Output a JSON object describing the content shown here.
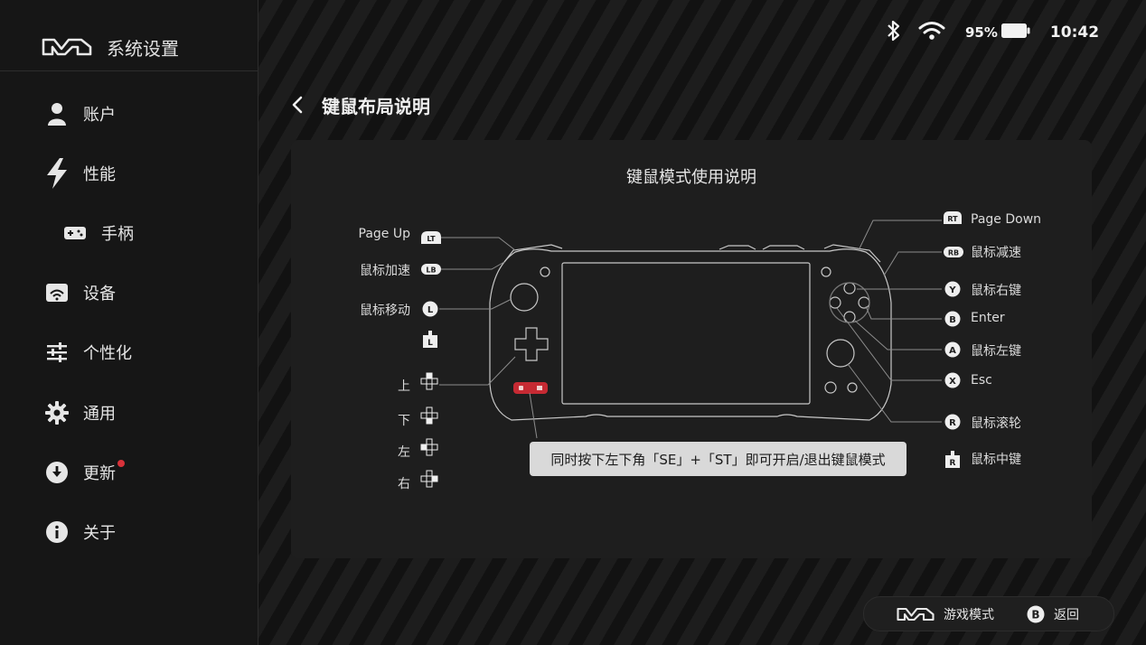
{
  "sidebar": {
    "app_title": "系统设置",
    "items": [
      {
        "label": "账户",
        "icon": "person-icon"
      },
      {
        "label": "性能",
        "icon": "lightning-icon"
      },
      {
        "label": "手柄",
        "icon": "gamepad-icon"
      },
      {
        "label": "设备",
        "icon": "device-icon"
      },
      {
        "label": "个性化",
        "icon": "sliders-icon"
      },
      {
        "label": "通用",
        "icon": "gear-icon"
      },
      {
        "label": "更新",
        "icon": "download-icon"
      },
      {
        "label": "关于",
        "icon": "info-icon"
      }
    ]
  },
  "status": {
    "battery": "95%",
    "time": "10:42"
  },
  "page": {
    "title": "键鼠布局说明"
  },
  "panel": {
    "title": "键鼠模式使用说明",
    "tip": "同时按下左下角「SE」+「ST」即可开启/退出键鼠模式"
  },
  "left_controls": [
    {
      "label": "Page Up",
      "badge": "LT"
    },
    {
      "label": "鼠标加速",
      "badge": "LB"
    },
    {
      "label": "鼠标移动",
      "badge": "L"
    },
    {
      "label": "",
      "badge": "L"
    },
    {
      "label": "上",
      "badge": ""
    },
    {
      "label": "下",
      "badge": ""
    },
    {
      "label": "左",
      "badge": ""
    },
    {
      "label": "右",
      "badge": ""
    }
  ],
  "right_controls": [
    {
      "label": "Page Down",
      "badge": "RT"
    },
    {
      "label": "鼠标减速",
      "badge": "RB"
    },
    {
      "label": "鼠标右键",
      "badge": "Y"
    },
    {
      "label": "Enter",
      "badge": "B"
    },
    {
      "label": "鼠标左键",
      "badge": "A"
    },
    {
      "label": "Esc",
      "badge": "X"
    },
    {
      "label": "鼠标滚轮",
      "badge": "R"
    },
    {
      "label": "鼠标中键",
      "badge": "R"
    }
  ],
  "bottom_bar": {
    "game_mode": "游戏模式",
    "back_badge": "B",
    "back": "返回"
  },
  "colors": {
    "accent_red": "#d8323a",
    "tip_bg": "#d9d9d9",
    "panel_bg": "#1e1e1e"
  }
}
